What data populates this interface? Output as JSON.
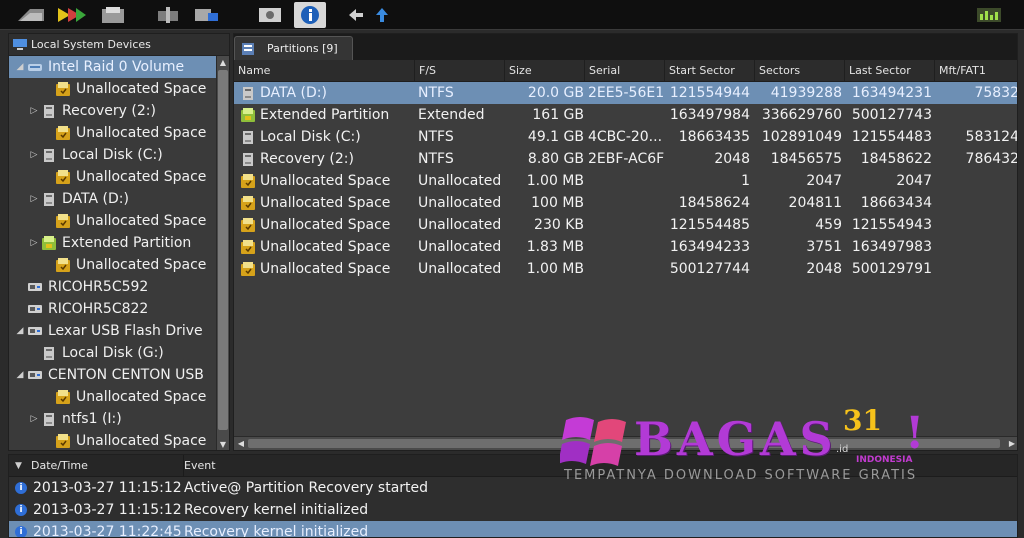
{
  "left_panel": {
    "title": "Local System Devices",
    "tree": [
      {
        "label": "Intel   Raid 0 Volume",
        "icon": "raid-volume-icon",
        "arrow": "◢",
        "indent": 0,
        "selected": true
      },
      {
        "label": "Unallocated Space",
        "icon": "unallocated-icon",
        "arrow": "",
        "indent": 2
      },
      {
        "label": "Recovery (2:)",
        "icon": "disk-icon",
        "arrow": "▷",
        "indent": 1
      },
      {
        "label": "Unallocated Space",
        "icon": "unallocated-icon",
        "arrow": "",
        "indent": 2
      },
      {
        "label": "Local Disk (C:)",
        "icon": "disk-icon",
        "arrow": "▷",
        "indent": 1
      },
      {
        "label": "Unallocated Space",
        "icon": "unallocated-icon",
        "arrow": "",
        "indent": 2
      },
      {
        "label": "DATA (D:)",
        "icon": "disk-icon",
        "arrow": "▷",
        "indent": 1
      },
      {
        "label": "Unallocated Space",
        "icon": "unallocated-icon",
        "arrow": "",
        "indent": 2
      },
      {
        "label": "Extended Partition",
        "icon": "extended-partition-icon",
        "arrow": "▷",
        "indent": 1
      },
      {
        "label": "Unallocated Space",
        "icon": "unallocated-icon",
        "arrow": "",
        "indent": 2
      },
      {
        "label": "RICOHR5C592",
        "icon": "device-icon",
        "arrow": "",
        "indent": 0
      },
      {
        "label": "RICOHR5C822",
        "icon": "device-icon",
        "arrow": "",
        "indent": 0
      },
      {
        "label": "Lexar   USB Flash Drive",
        "icon": "usb-drive-icon",
        "arrow": "◢",
        "indent": 0
      },
      {
        "label": "Local Disk (G:)",
        "icon": "disk-icon",
        "arrow": "",
        "indent": 1
      },
      {
        "label": "CENTON  CENTON USB",
        "icon": "usb-drive-icon",
        "arrow": "◢",
        "indent": 0
      },
      {
        "label": "Unallocated Space",
        "icon": "unallocated-icon",
        "arrow": "",
        "indent": 2
      },
      {
        "label": "ntfs1 (I:)",
        "icon": "disk-icon",
        "arrow": "▷",
        "indent": 1
      },
      {
        "label": "Unallocated Space",
        "icon": "unallocated-icon",
        "arrow": "",
        "indent": 2
      }
    ]
  },
  "right_panel": {
    "tab_label": "Partitions [9]",
    "columns": [
      "Name",
      "F/S",
      "Size",
      "Serial",
      "Start Sector",
      "Sectors",
      "Last Sector",
      "Mft/FAT1"
    ],
    "rows": [
      {
        "name": "DATA (D:)",
        "fs": "NTFS",
        "size": "20.0 GB",
        "serial": "2EE5-56E1",
        "start": "121554944",
        "sectors": "41939288",
        "last": "163494231",
        "mft": "75832",
        "icon": "disk-icon",
        "selected": true
      },
      {
        "name": "Extended Partition",
        "fs": "Extended",
        "size": "161 GB",
        "serial": "",
        "start": "163497984",
        "sectors": "336629760",
        "last": "500127743",
        "mft": "",
        "icon": "extended-partition-icon"
      },
      {
        "name": "Local Disk (C:)",
        "fs": "NTFS",
        "size": "49.1 GB",
        "serial": "4CBC-20...",
        "start": "18663435",
        "sectors": "102891049",
        "last": "121554483",
        "mft": "583124",
        "icon": "disk-icon"
      },
      {
        "name": "Recovery (2:)",
        "fs": "NTFS",
        "size": "8.80 GB",
        "serial": "2EBF-AC6F",
        "start": "2048",
        "sectors": "18456575",
        "last": "18458622",
        "mft": "786432",
        "icon": "disk-icon"
      },
      {
        "name": "Unallocated Space",
        "fs": "Unallocated",
        "size": "1.00 MB",
        "serial": "",
        "start": "1",
        "sectors": "2047",
        "last": "2047",
        "mft": "",
        "icon": "unallocated-icon"
      },
      {
        "name": "Unallocated Space",
        "fs": "Unallocated",
        "size": "100 MB",
        "serial": "",
        "start": "18458624",
        "sectors": "204811",
        "last": "18663434",
        "mft": "",
        "icon": "unallocated-icon"
      },
      {
        "name": "Unallocated Space",
        "fs": "Unallocated",
        "size": "230 KB",
        "serial": "",
        "start": "121554485",
        "sectors": "459",
        "last": "121554943",
        "mft": "",
        "icon": "unallocated-icon"
      },
      {
        "name": "Unallocated Space",
        "fs": "Unallocated",
        "size": "1.83 MB",
        "serial": "",
        "start": "163494233",
        "sectors": "3751",
        "last": "163497983",
        "mft": "",
        "icon": "unallocated-icon"
      },
      {
        "name": "Unallocated Space",
        "fs": "Unallocated",
        "size": "1.00 MB",
        "serial": "",
        "start": "500127744",
        "sectors": "2048",
        "last": "500129791",
        "mft": "",
        "icon": "unallocated-icon"
      }
    ]
  },
  "log_panel": {
    "col_date": "Date/Time",
    "col_event": "Event",
    "entries": [
      {
        "time": "2013-03-27 11:15:12",
        "event": "Active@ Partition Recovery started"
      },
      {
        "time": "2013-03-27 11:15:12",
        "event": "Recovery kernel initialized"
      },
      {
        "time": "2013-03-27 11:22:45",
        "event": "Recovery kernel initialized",
        "selected": true
      }
    ]
  },
  "watermark": {
    "brand": "BAGAS",
    "number": "31",
    "domain": ".id",
    "country": "INDONESIA",
    "exclaim": "!",
    "tagline": "TEMPATNYA DOWNLOAD SOFTWARE GRATIS"
  },
  "colors": {
    "selection": "#6d8fb4",
    "accent": "#2f6ed6",
    "watermark_purple": "#b23ad6",
    "watermark_gold": "#f6c21b"
  }
}
